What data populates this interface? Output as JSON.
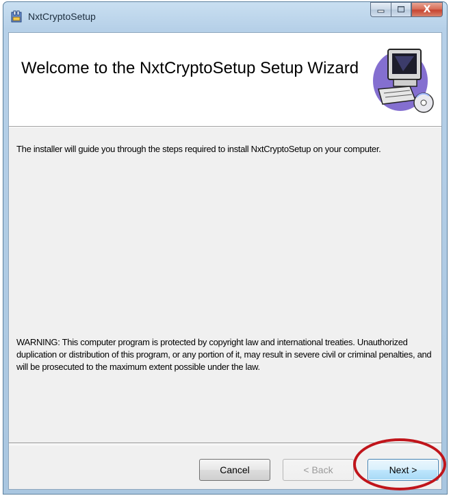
{
  "window": {
    "title": "NxtCryptoSetup",
    "close_glyph": "X"
  },
  "banner": {
    "title": "Welcome to the NxtCryptoSetup Setup Wizard",
    "graphic_icon": "computer-cd-icon"
  },
  "body": {
    "intro": "The installer will guide you through the steps required to install NxtCryptoSetup on your computer.",
    "warning": "WARNING: This computer program is protected by copyright law and international treaties. Unauthorized duplication or distribution of this program, or any portion of it, may result in severe civil or criminal penalties, and will be prosecuted to the maximum extent possible under the law."
  },
  "buttons": {
    "cancel": "Cancel",
    "back": "< Back",
    "next": "Next >"
  },
  "colors": {
    "highlight_ring": "#c0151b",
    "close_button": "#c74532"
  }
}
